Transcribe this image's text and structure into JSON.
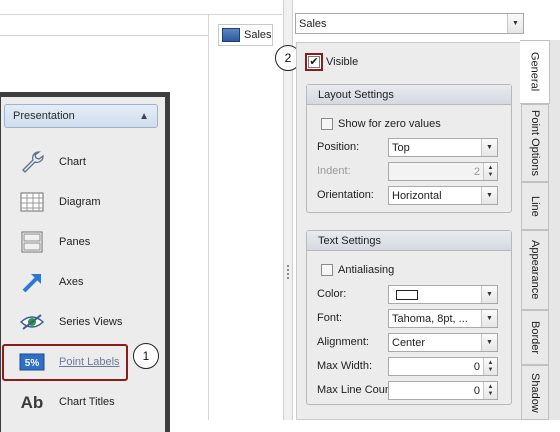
{
  "legend": {
    "label": "Sales",
    "color": "#3a68b0"
  },
  "nav": {
    "header": "Presentation",
    "items": [
      {
        "label": "Chart",
        "icon": "wrench-icon"
      },
      {
        "label": "Diagram",
        "icon": "diagram-grid-icon"
      },
      {
        "label": "Panes",
        "icon": "panes-icon"
      },
      {
        "label": "Axes",
        "icon": "axes-arrow-icon"
      },
      {
        "label": "Series Views",
        "icon": "series-views-eye-icon"
      },
      {
        "label": "Point Labels",
        "icon": "point-labels-5pct-icon",
        "icon_text": "5%"
      },
      {
        "label": "Chart Titles",
        "icon": "chart-titles-ab-icon",
        "icon_text": "Ab"
      }
    ]
  },
  "callouts": {
    "one": "1",
    "two": "2"
  },
  "series_combo": {
    "value": "Sales"
  },
  "visible": {
    "label": "Visible",
    "checked": true
  },
  "layout_settings": {
    "title": "Layout Settings",
    "show_zero": "Show for zero values",
    "position_label": "Position:",
    "position_value": "Top",
    "indent_label": "Indent:",
    "indent_value": "2",
    "orientation_label": "Orientation:",
    "orientation_value": "Horizontal"
  },
  "text_settings": {
    "title": "Text Settings",
    "antialiasing": "Antialiasing",
    "color_label": "Color:",
    "color_value": "#ffffff",
    "font_label": "Font:",
    "font_value": "Tahoma, 8pt, ...",
    "alignment_label": "Alignment:",
    "alignment_value": "Center",
    "max_width_label": "Max Width:",
    "max_width_value": "0",
    "max_line_label": "Max Line Count:",
    "max_line_value": "0"
  },
  "tabs": [
    "General",
    "Point Options",
    "Line",
    "Appearance",
    "Border",
    "Shadow"
  ],
  "accent": "#8c1c1c"
}
